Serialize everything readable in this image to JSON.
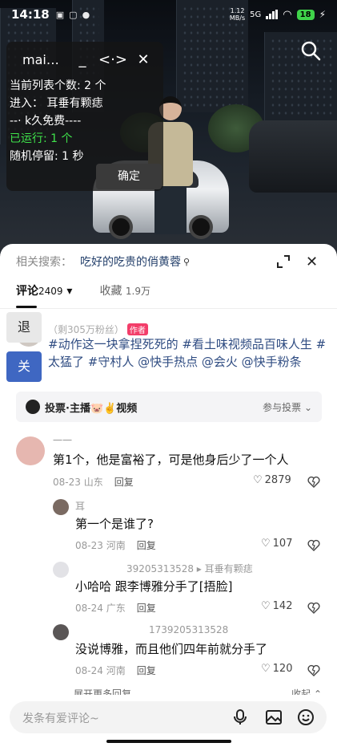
{
  "status": {
    "time": "14:18",
    "net_speed_value": "1.12",
    "net_speed_unit": "MB/s",
    "network": "5G",
    "battery": "18"
  },
  "panel": {
    "title": "mai…",
    "min_label": "_",
    "move_label": "<·>",
    "close_label": "✕",
    "line1": "当前列表个数: 2 个",
    "line2": "进入：  耳垂有颗痣",
    "line3": "--·          k久免费----",
    "line4": "已运行:  1 个",
    "line5": "随机停留:  1 秒",
    "confirm": "确定"
  },
  "sheet": {
    "related_label": "相关搜索：",
    "related_keyword": "吃好的吃贵的俏黄蓉",
    "tabs": [
      {
        "label": "评论",
        "count": "2409"
      },
      {
        "label": "收藏",
        "count": "1.9万"
      }
    ],
    "author_meta": "（剩305万粉丝）",
    "author_tag": "作者",
    "description": "#动作这一块拿捏死死的 #看土味视频品百味人生 #太猛了 #守村人 @快手热点 @会火 @快手粉条",
    "vote": {
      "text": "投票·主播🐷✌️视频",
      "join": "参与投票"
    }
  },
  "comments": [
    {
      "name": "一一",
      "text": "第1个，他是富裕了，可是他身后少了一个人",
      "date": "08-23",
      "loc": "山东",
      "reply": "回复",
      "likes": "2879"
    },
    {
      "name": "耳",
      "text": "第一个是谁了?",
      "date": "08-23",
      "loc": "河南",
      "reply": "回复",
      "likes": "107"
    },
    {
      "name": "39205313528",
      "reply_to": "耳垂有颗痣",
      "text": "小哈哈  跟李博雅分手了[捂脸]",
      "date": "08-24",
      "loc": "广东",
      "reply": "回复",
      "likes": "142"
    },
    {
      "name": "1739205313528",
      "text": "没说博雅，而且他们四年前就分手了",
      "date": "08-24",
      "loc": "河南",
      "reply": "回复",
      "likes": "120"
    }
  ],
  "more": {
    "expand": "展开更多回复",
    "collapse": "收起"
  },
  "input": {
    "placeholder": "发条有爱评论~"
  },
  "side": {
    "exit": "退",
    "close": "关"
  },
  "colors": {
    "accent_link": "#2f4c82",
    "author_tag": "#f33e6a",
    "green_status": "#3fe34b",
    "side_close": "#3f67c2"
  }
}
